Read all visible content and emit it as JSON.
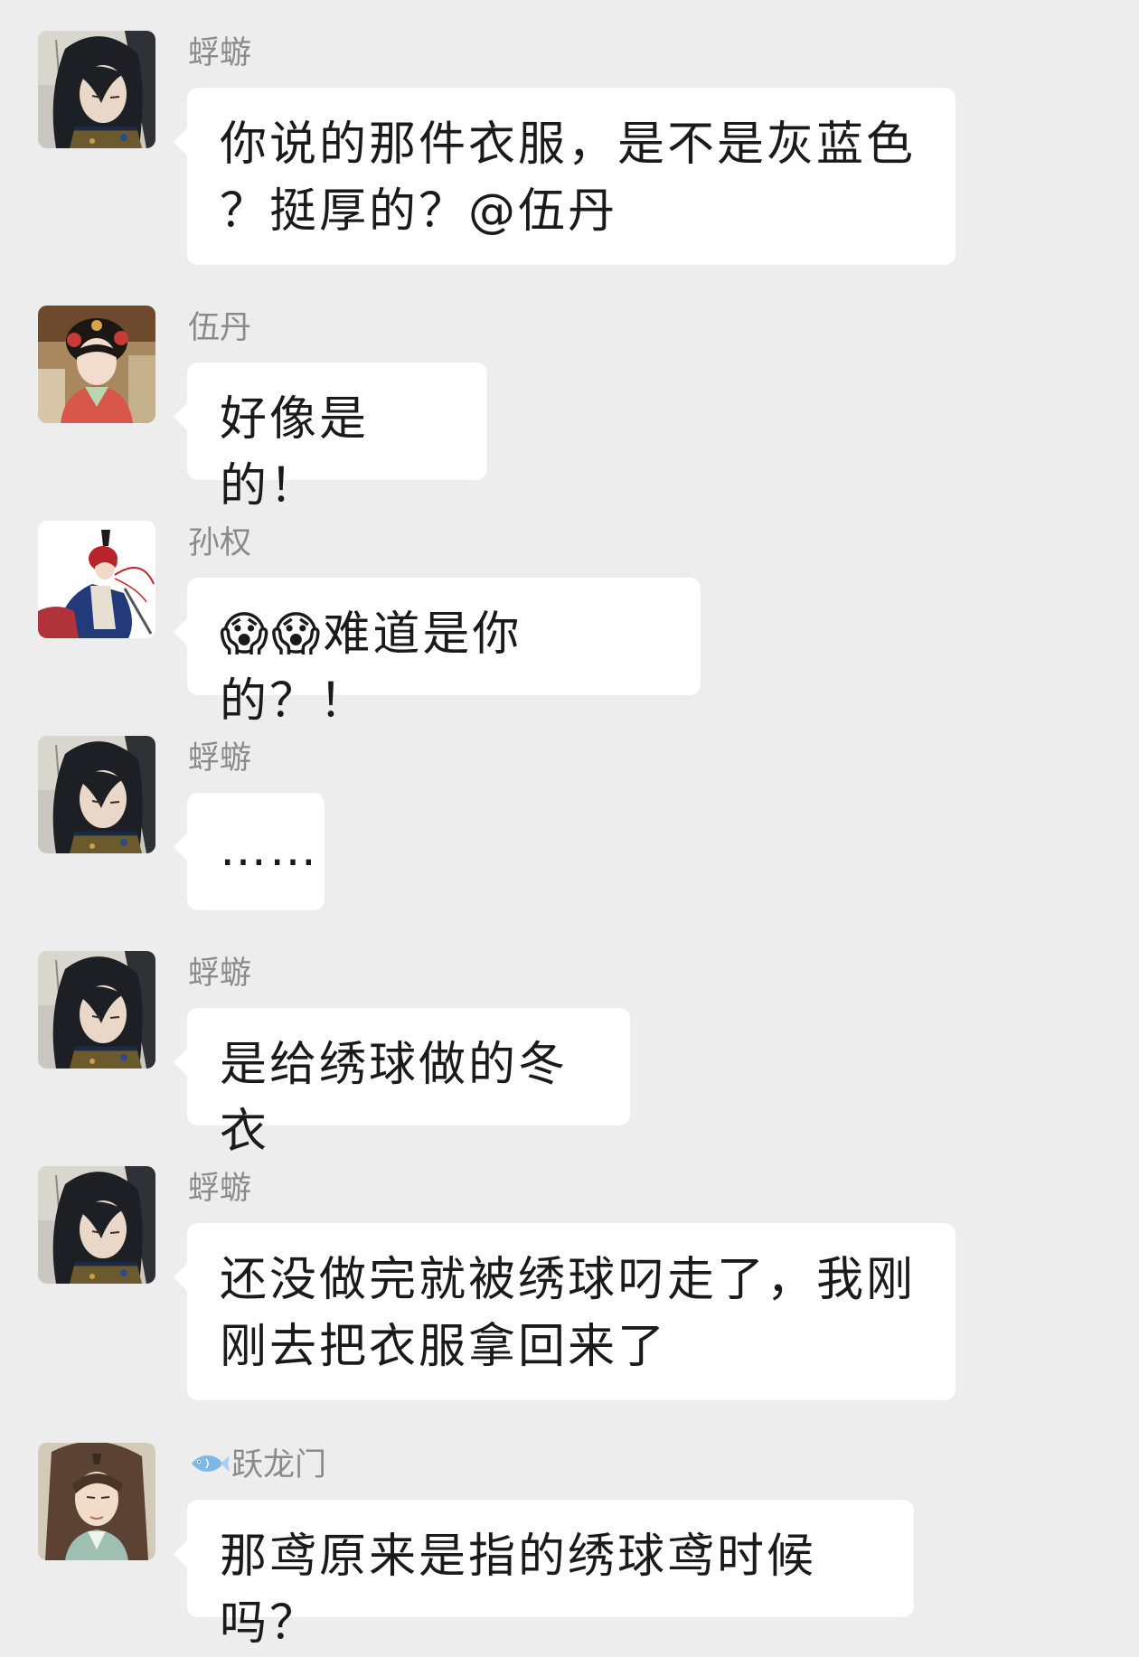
{
  "colors": {
    "background": "#ededed",
    "bubble": "#ffffff",
    "sender_name": "#8a8a8a",
    "message_text": "#1a1a1a"
  },
  "messages": [
    {
      "avatar_icon": "dark-hair-man-avatar-icon",
      "sender": "蜉蝣",
      "lines": [
        "你说的那件衣服，是不是灰蓝色",
        "？挺厚的？@伍丹"
      ]
    },
    {
      "avatar_icon": "woman-red-hairpiece-avatar-icon",
      "sender": "伍丹",
      "lines": [
        "好像是的！"
      ]
    },
    {
      "avatar_icon": "red-hair-man-avatar-icon",
      "sender": "孙权",
      "emoji": "😱😱",
      "lines": [
        "难道是你的？！"
      ]
    },
    {
      "avatar_icon": "dark-hair-man-avatar-icon",
      "sender": "蜉蝣",
      "lines": [
        "……"
      ]
    },
    {
      "avatar_icon": "dark-hair-man-avatar-icon",
      "sender": "蜉蝣",
      "lines": [
        "是给绣球做的冬衣"
      ]
    },
    {
      "avatar_icon": "dark-hair-man-avatar-icon",
      "sender": "蜉蝣",
      "lines": [
        "还没做完就被绣球叼走了，我刚",
        "刚去把衣服拿回来了"
      ]
    },
    {
      "avatar_icon": "long-hair-man-avatar-icon",
      "sender_badge_icon": "fish-icon",
      "sender": "跃龙门",
      "lines": [
        "那鸢原来是指的绣球鸢时候吗？"
      ]
    }
  ]
}
